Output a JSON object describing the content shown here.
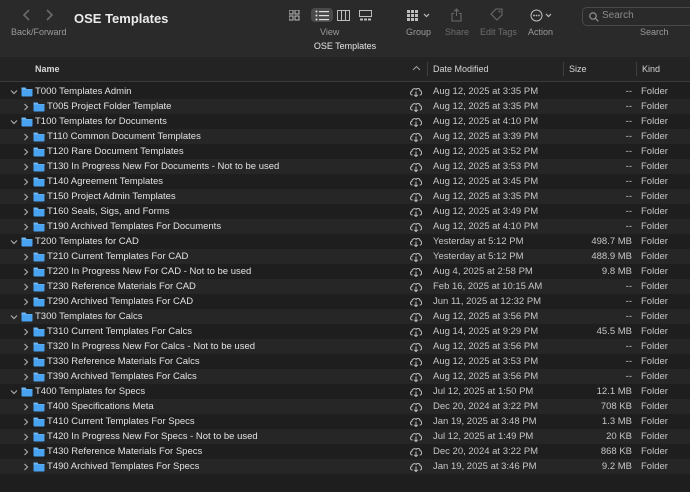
{
  "toolbar": {
    "nav_label": "Back/Forward",
    "window_title": "OSE Templates",
    "view_label": "View",
    "group_label": "Group",
    "share_label": "Share",
    "edit_tags_label": "Edit Tags",
    "action_label": "Action",
    "search_placeholder": "Search",
    "search_label": "Search"
  },
  "path_title": "OSE Templates",
  "columns": {
    "name": "Name",
    "date": "Date Modified",
    "size": "Size",
    "kind": "Kind"
  },
  "colors": {
    "folder": "#4aa3f0",
    "folder_tab": "#6fb8f5",
    "background": "#1e1e1e",
    "toolbar": "#2a2a2a"
  },
  "rows": [
    {
      "name": "T000 Templates Admin",
      "level": 0,
      "expanded": true,
      "date": "Aug 12, 2025 at 3:35 PM",
      "size": "--",
      "kind": "Folder"
    },
    {
      "name": "T005 Project Folder Template",
      "level": 1,
      "expanded": false,
      "date": "Aug 12, 2025 at 3:35 PM",
      "size": "--",
      "kind": "Folder"
    },
    {
      "name": "T100 Templates for Documents",
      "level": 0,
      "expanded": true,
      "date": "Aug 12, 2025 at 4:10 PM",
      "size": "--",
      "kind": "Folder"
    },
    {
      "name": "T110 Common Document Templates",
      "level": 1,
      "expanded": false,
      "date": "Aug 12, 2025 at 3:39 PM",
      "size": "--",
      "kind": "Folder"
    },
    {
      "name": "T120 Rare Document Templates",
      "level": 1,
      "expanded": false,
      "date": "Aug 12, 2025 at 3:52 PM",
      "size": "--",
      "kind": "Folder"
    },
    {
      "name": "T130 In Progress New For Documents - Not to be used",
      "level": 1,
      "expanded": false,
      "date": "Aug 12, 2025 at 3:53 PM",
      "size": "--",
      "kind": "Folder"
    },
    {
      "name": "T140 Agreement Templates",
      "level": 1,
      "expanded": false,
      "date": "Aug 12, 2025 at 3:45 PM",
      "size": "--",
      "kind": "Folder"
    },
    {
      "name": "T150 Project Admin Templates",
      "level": 1,
      "expanded": false,
      "date": "Aug 12, 2025 at 3:35 PM",
      "size": "--",
      "kind": "Folder"
    },
    {
      "name": "T160 Seals, Sigs, and Forms",
      "level": 1,
      "expanded": false,
      "date": "Aug 12, 2025 at 3:49 PM",
      "size": "--",
      "kind": "Folder"
    },
    {
      "name": "T190 Archived Templates For Documents",
      "level": 1,
      "expanded": false,
      "date": "Aug 12, 2025 at 4:10 PM",
      "size": "--",
      "kind": "Folder"
    },
    {
      "name": "T200 Templates for CAD",
      "level": 0,
      "expanded": true,
      "date": "Yesterday at 5:12 PM",
      "size": "498.7 MB",
      "kind": "Folder"
    },
    {
      "name": "T210 Current Templates For CAD",
      "level": 1,
      "expanded": false,
      "date": "Yesterday at 5:12 PM",
      "size": "488.9 MB",
      "kind": "Folder"
    },
    {
      "name": "T220 In Progress New For CAD - Not to be used",
      "level": 1,
      "expanded": false,
      "date": "Aug 4, 2025 at 2:58 PM",
      "size": "9.8 MB",
      "kind": "Folder"
    },
    {
      "name": "T230 Reference Materials For CAD",
      "level": 1,
      "expanded": false,
      "date": "Feb 16, 2025 at 10:15 AM",
      "size": "--",
      "kind": "Folder"
    },
    {
      "name": "T290 Archived Templates For CAD",
      "level": 1,
      "expanded": false,
      "date": "Jun 11, 2025 at 12:32 PM",
      "size": "--",
      "kind": "Folder"
    },
    {
      "name": "T300 Templates for Calcs",
      "level": 0,
      "expanded": true,
      "date": "Aug 12, 2025 at 3:56 PM",
      "size": "--",
      "kind": "Folder"
    },
    {
      "name": "T310 Current Templates For Calcs",
      "level": 1,
      "expanded": false,
      "date": "Aug 14, 2025 at 9:29 PM",
      "size": "45.5 MB",
      "kind": "Folder"
    },
    {
      "name": "T320 In Progress New For Calcs - Not to be used",
      "level": 1,
      "expanded": false,
      "date": "Aug 12, 2025 at 3:56 PM",
      "size": "--",
      "kind": "Folder"
    },
    {
      "name": "T330 Reference Materials For Calcs",
      "level": 1,
      "expanded": false,
      "date": "Aug 12, 2025 at 3:53 PM",
      "size": "--",
      "kind": "Folder"
    },
    {
      "name": "T390 Archived Templates For Calcs",
      "level": 1,
      "expanded": false,
      "date": "Aug 12, 2025 at 3:56 PM",
      "size": "--",
      "kind": "Folder"
    },
    {
      "name": "T400 Templates for Specs",
      "level": 0,
      "expanded": true,
      "date": "Jul 12, 2025 at 1:50 PM",
      "size": "12.1 MB",
      "kind": "Folder"
    },
    {
      "name": "T400 Specifications Meta",
      "level": 1,
      "expanded": false,
      "date": "Dec 20, 2024 at 3:22 PM",
      "size": "708 KB",
      "kind": "Folder"
    },
    {
      "name": "T410 Current Templates For Specs",
      "level": 1,
      "expanded": false,
      "date": "Jan 19, 2025 at 3:48 PM",
      "size": "1.3 MB",
      "kind": "Folder"
    },
    {
      "name": "T420 In Progress New For Specs - Not to be used",
      "level": 1,
      "expanded": false,
      "date": "Jul 12, 2025 at 1:49 PM",
      "size": "20 KB",
      "kind": "Folder"
    },
    {
      "name": "T430 Reference Materials For Specs",
      "level": 1,
      "expanded": false,
      "date": "Dec 20, 2024 at 3:22 PM",
      "size": "868 KB",
      "kind": "Folder"
    },
    {
      "name": "T490 Archived Templates For Specs",
      "level": 1,
      "expanded": false,
      "date": "Jan 19, 2025 at 3:46 PM",
      "size": "9.2 MB",
      "kind": "Folder"
    }
  ]
}
